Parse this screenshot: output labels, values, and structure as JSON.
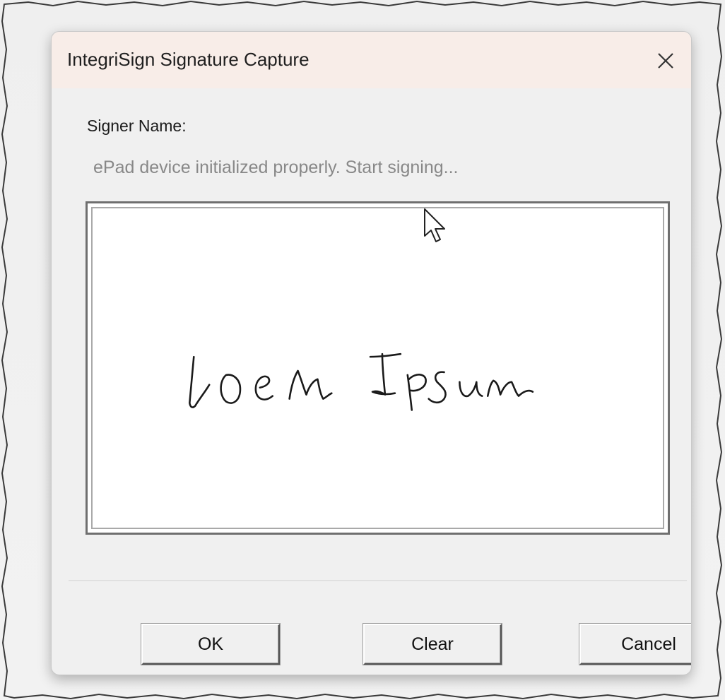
{
  "dialog": {
    "title": "IntegriSign Signature Capture",
    "close_icon": "close-icon",
    "signer_label": "Signer Name:",
    "status": "ePad device initialized properly. Start signing...",
    "signature_ink_color": "#1a1a1a",
    "title_bar_color": "#f8ede8"
  },
  "buttons": {
    "ok": "OK",
    "clear": "Clear",
    "cancel": "Cancel"
  }
}
